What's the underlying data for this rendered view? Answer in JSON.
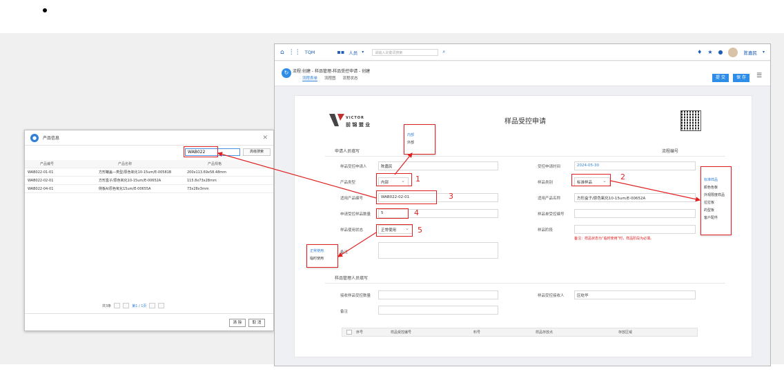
{
  "dialog": {
    "title": "产品信息",
    "search_value": "WAB022",
    "search_button": "高级搜索",
    "columns": [
      "产品编号",
      "产品名称",
      "产品规格"
    ],
    "rows": [
      [
        "WAB022-01-01",
        "方形罐盖—类型/原色氧化10-15um/E-00581B",
        "200x113.69x58.48mm"
      ],
      [
        "WAB022-02-01",
        "方形盒子/原色氧化10-15um/E-00652A",
        "115.8x73x28mm"
      ],
      [
        "WAB022-04-01",
        "侧板A/原色氧化15um/E-00655A",
        "73x28x3mm"
      ]
    ],
    "pager": {
      "total": "共3条",
      "page": "第1 / 1页"
    },
    "clear_button": "清 除",
    "cancel_button": "取 消"
  },
  "app": {
    "name": "TQM",
    "nav_menu": "人员",
    "search_placeholder": "请输入关键词搜索",
    "user": "陈嘉民",
    "breadcrumb": "流程:创建 - 样品管理-样品受控申请 - 创建",
    "tabs": [
      "流程表单",
      "流程图",
      "流程状态"
    ],
    "submit_button": "提 交",
    "save_button": "保 存"
  },
  "form": {
    "logo_text": "VICTOR",
    "logo_subtext": "前 锦 盟 业",
    "title": "样品受控申请",
    "section_applicant": "申请人员填写",
    "flow_no_label": "流程编号",
    "applicant_label": "样品受控申请人",
    "applicant_value": "陈嘉民",
    "apply_time_label": "受控申请时间",
    "apply_time_value": "2024-05-30",
    "product_type_label": "产品类型",
    "product_type_value": "内部",
    "sample_category_label": "样品类别",
    "sample_category_value": "标准样品",
    "product_no_label": "适用产品编号",
    "product_no_value": "WAB022-02-01",
    "product_name_label": "适用产品名称",
    "product_name_value": "方形盒子/原色氧化10-15um/E-00652A",
    "quantity_label": "申请受控样品数量",
    "quantity_value": "5",
    "sample_no_label": "样品单受控编号",
    "usage_label": "样品使用状态",
    "usage_value": "正常使用",
    "stage_label": "样品阶段",
    "remark_label": "备注",
    "note_text": "备注：样品状态为“临时使用”时，样品阶段为必填。",
    "section_admin": "样品管理人员填写",
    "receive_qty_label": "接收样品受控数量",
    "receiver_label": "样品受控接收人",
    "receiver_value": "区屹华",
    "admin_remark_label": "备注",
    "table_headers": [
      "序号",
      "样品受控编号",
      "料号",
      "样品存放点",
      "存放区域"
    ]
  },
  "popups": {
    "product_type_options": [
      "内部",
      "外部"
    ],
    "category_options": [
      "标准样品",
      "颜色色板",
      "外观限度样品",
      "拉拉板",
      "的型板",
      "客户配件"
    ],
    "usage_options": [
      "正常使用",
      "临时使用"
    ]
  },
  "annotations": [
    "1",
    "2",
    "3",
    "4",
    "5"
  ],
  "colors": {
    "accent": "#2e8de6",
    "annotation": "#e02020"
  }
}
